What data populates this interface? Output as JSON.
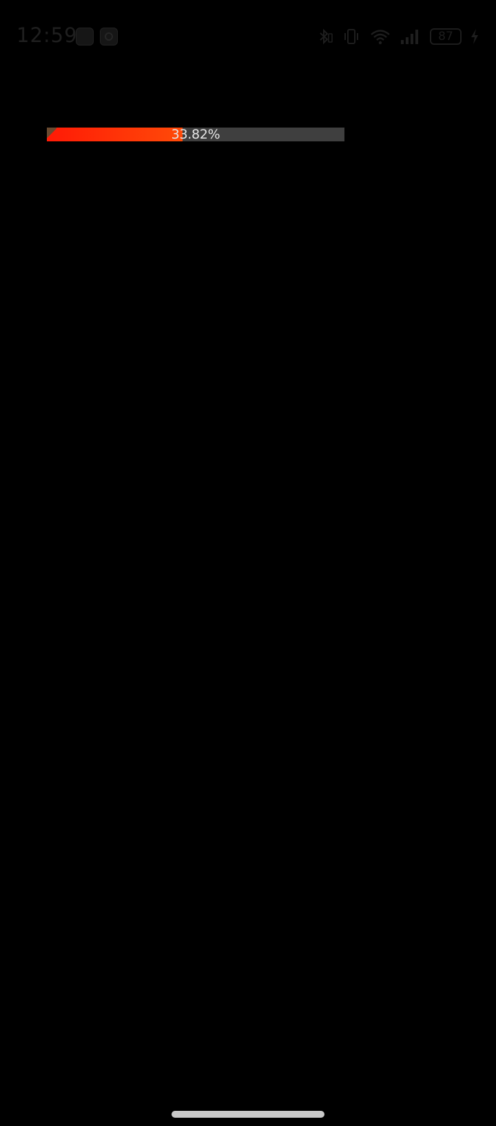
{
  "status_bar": {
    "time": "12:59",
    "battery_level": "87",
    "icons": [
      "notification-app-icon",
      "notification-app-icon",
      "bluetooth-icon",
      "vibrate-icon",
      "wifi-icon",
      "signal-icon",
      "battery-icon",
      "charging-icon"
    ]
  },
  "progress": {
    "label": "33.82%",
    "value": 0.4558,
    "fill_color_start": "#ff1a06",
    "fill_color_end": "#ff4a08",
    "track_color": "#3f3f3f"
  }
}
